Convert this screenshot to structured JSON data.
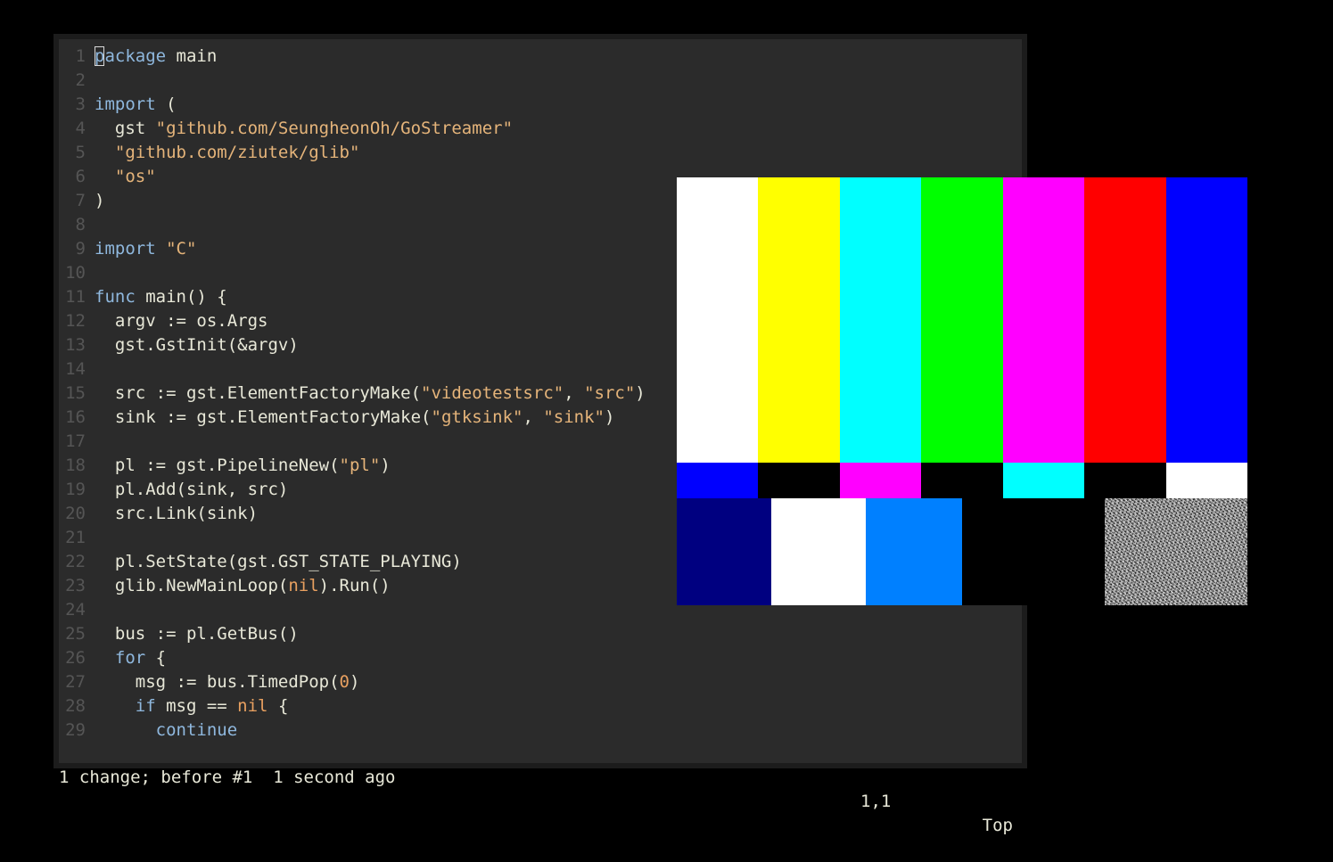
{
  "editor": {
    "lines": [
      {
        "n": "1",
        "tokens": [
          {
            "t": "package",
            "c": "kw",
            "cursor": true
          },
          {
            "t": " main",
            "c": "plain"
          }
        ]
      },
      {
        "n": "2",
        "tokens": []
      },
      {
        "n": "3",
        "tokens": [
          {
            "t": "import",
            "c": "kw"
          },
          {
            "t": " (",
            "c": "plain"
          }
        ]
      },
      {
        "n": "4",
        "tokens": [
          {
            "t": "  gst ",
            "c": "plain"
          },
          {
            "t": "\"github.com/SeungheonOh/GoStreamer\"",
            "c": "str"
          }
        ]
      },
      {
        "n": "5",
        "tokens": [
          {
            "t": "  ",
            "c": "plain"
          },
          {
            "t": "\"github.com/ziutek/glib\"",
            "c": "str"
          }
        ]
      },
      {
        "n": "6",
        "tokens": [
          {
            "t": "  ",
            "c": "plain"
          },
          {
            "t": "\"os\"",
            "c": "str"
          }
        ]
      },
      {
        "n": "7",
        "tokens": [
          {
            "t": ")",
            "c": "plain"
          }
        ]
      },
      {
        "n": "8",
        "tokens": []
      },
      {
        "n": "9",
        "tokens": [
          {
            "t": "import",
            "c": "kw"
          },
          {
            "t": " ",
            "c": "plain"
          },
          {
            "t": "\"C\"",
            "c": "str"
          }
        ]
      },
      {
        "n": "10",
        "tokens": []
      },
      {
        "n": "11",
        "tokens": [
          {
            "t": "func",
            "c": "kw"
          },
          {
            "t": " main() {",
            "c": "plain"
          }
        ]
      },
      {
        "n": "12",
        "tokens": [
          {
            "t": "  argv := os.Args",
            "c": "plain"
          }
        ]
      },
      {
        "n": "13",
        "tokens": [
          {
            "t": "  gst.GstInit(&argv)",
            "c": "plain"
          }
        ]
      },
      {
        "n": "14",
        "tokens": []
      },
      {
        "n": "15",
        "tokens": [
          {
            "t": "  src := gst.ElementFactoryMake(",
            "c": "plain"
          },
          {
            "t": "\"videotestsrc\"",
            "c": "str"
          },
          {
            "t": ", ",
            "c": "plain"
          },
          {
            "t": "\"src\"",
            "c": "str"
          },
          {
            "t": ")",
            "c": "plain"
          }
        ]
      },
      {
        "n": "16",
        "tokens": [
          {
            "t": "  sink := gst.ElementFactoryMake(",
            "c": "plain"
          },
          {
            "t": "\"gtksink\"",
            "c": "str"
          },
          {
            "t": ", ",
            "c": "plain"
          },
          {
            "t": "\"sink\"",
            "c": "str"
          },
          {
            "t": ")",
            "c": "plain"
          }
        ]
      },
      {
        "n": "17",
        "tokens": []
      },
      {
        "n": "18",
        "tokens": [
          {
            "t": "  pl := gst.PipelineNew(",
            "c": "plain"
          },
          {
            "t": "\"pl\"",
            "c": "str"
          },
          {
            "t": ")",
            "c": "plain"
          }
        ]
      },
      {
        "n": "19",
        "tokens": [
          {
            "t": "  pl.Add(sink, src)",
            "c": "plain"
          }
        ]
      },
      {
        "n": "20",
        "tokens": [
          {
            "t": "  src.Link(sink)",
            "c": "plain"
          }
        ]
      },
      {
        "n": "21",
        "tokens": []
      },
      {
        "n": "22",
        "tokens": [
          {
            "t": "  pl.SetState(gst.GST_STATE_PLAYING)",
            "c": "plain"
          }
        ]
      },
      {
        "n": "23",
        "tokens": [
          {
            "t": "  glib.NewMainLoop(",
            "c": "plain"
          },
          {
            "t": "nil",
            "c": "const"
          },
          {
            "t": ").Run()",
            "c": "plain"
          }
        ]
      },
      {
        "n": "24",
        "tokens": []
      },
      {
        "n": "25",
        "tokens": [
          {
            "t": "  bus := pl.GetBus()",
            "c": "plain"
          }
        ]
      },
      {
        "n": "26",
        "tokens": [
          {
            "t": "  ",
            "c": "plain"
          },
          {
            "t": "for",
            "c": "kw"
          },
          {
            "t": " {",
            "c": "plain"
          }
        ]
      },
      {
        "n": "27",
        "tokens": [
          {
            "t": "    msg := bus.TimedPop(",
            "c": "plain"
          },
          {
            "t": "0",
            "c": "const"
          },
          {
            "t": ")",
            "c": "plain"
          }
        ]
      },
      {
        "n": "28",
        "tokens": [
          {
            "t": "    ",
            "c": "plain"
          },
          {
            "t": "if",
            "c": "kw"
          },
          {
            "t": " msg == ",
            "c": "plain"
          },
          {
            "t": "nil",
            "c": "const"
          },
          {
            "t": " {",
            "c": "plain"
          }
        ]
      },
      {
        "n": "29",
        "tokens": [
          {
            "t": "      ",
            "c": "plain"
          },
          {
            "t": "continue",
            "c": "kw"
          }
        ]
      }
    ]
  },
  "status": {
    "message": "1 change; before #1  1 second ago",
    "position": "1,1",
    "scroll": "Top"
  },
  "video": {
    "top_bars": [
      "#ffffff",
      "#ffff00",
      "#00ffff",
      "#00ff00",
      "#ff00ff",
      "#ff0000",
      "#0000ff"
    ],
    "middle_bars": [
      "#0000ff",
      "#000000",
      "#ff00ff",
      "#000000",
      "#00ffff",
      "#000000",
      "#ffffff"
    ],
    "bottom_blocks": [
      "#000080",
      "#ffffff",
      "#0080ff",
      "#000000",
      "#000000",
      "#131313"
    ]
  }
}
